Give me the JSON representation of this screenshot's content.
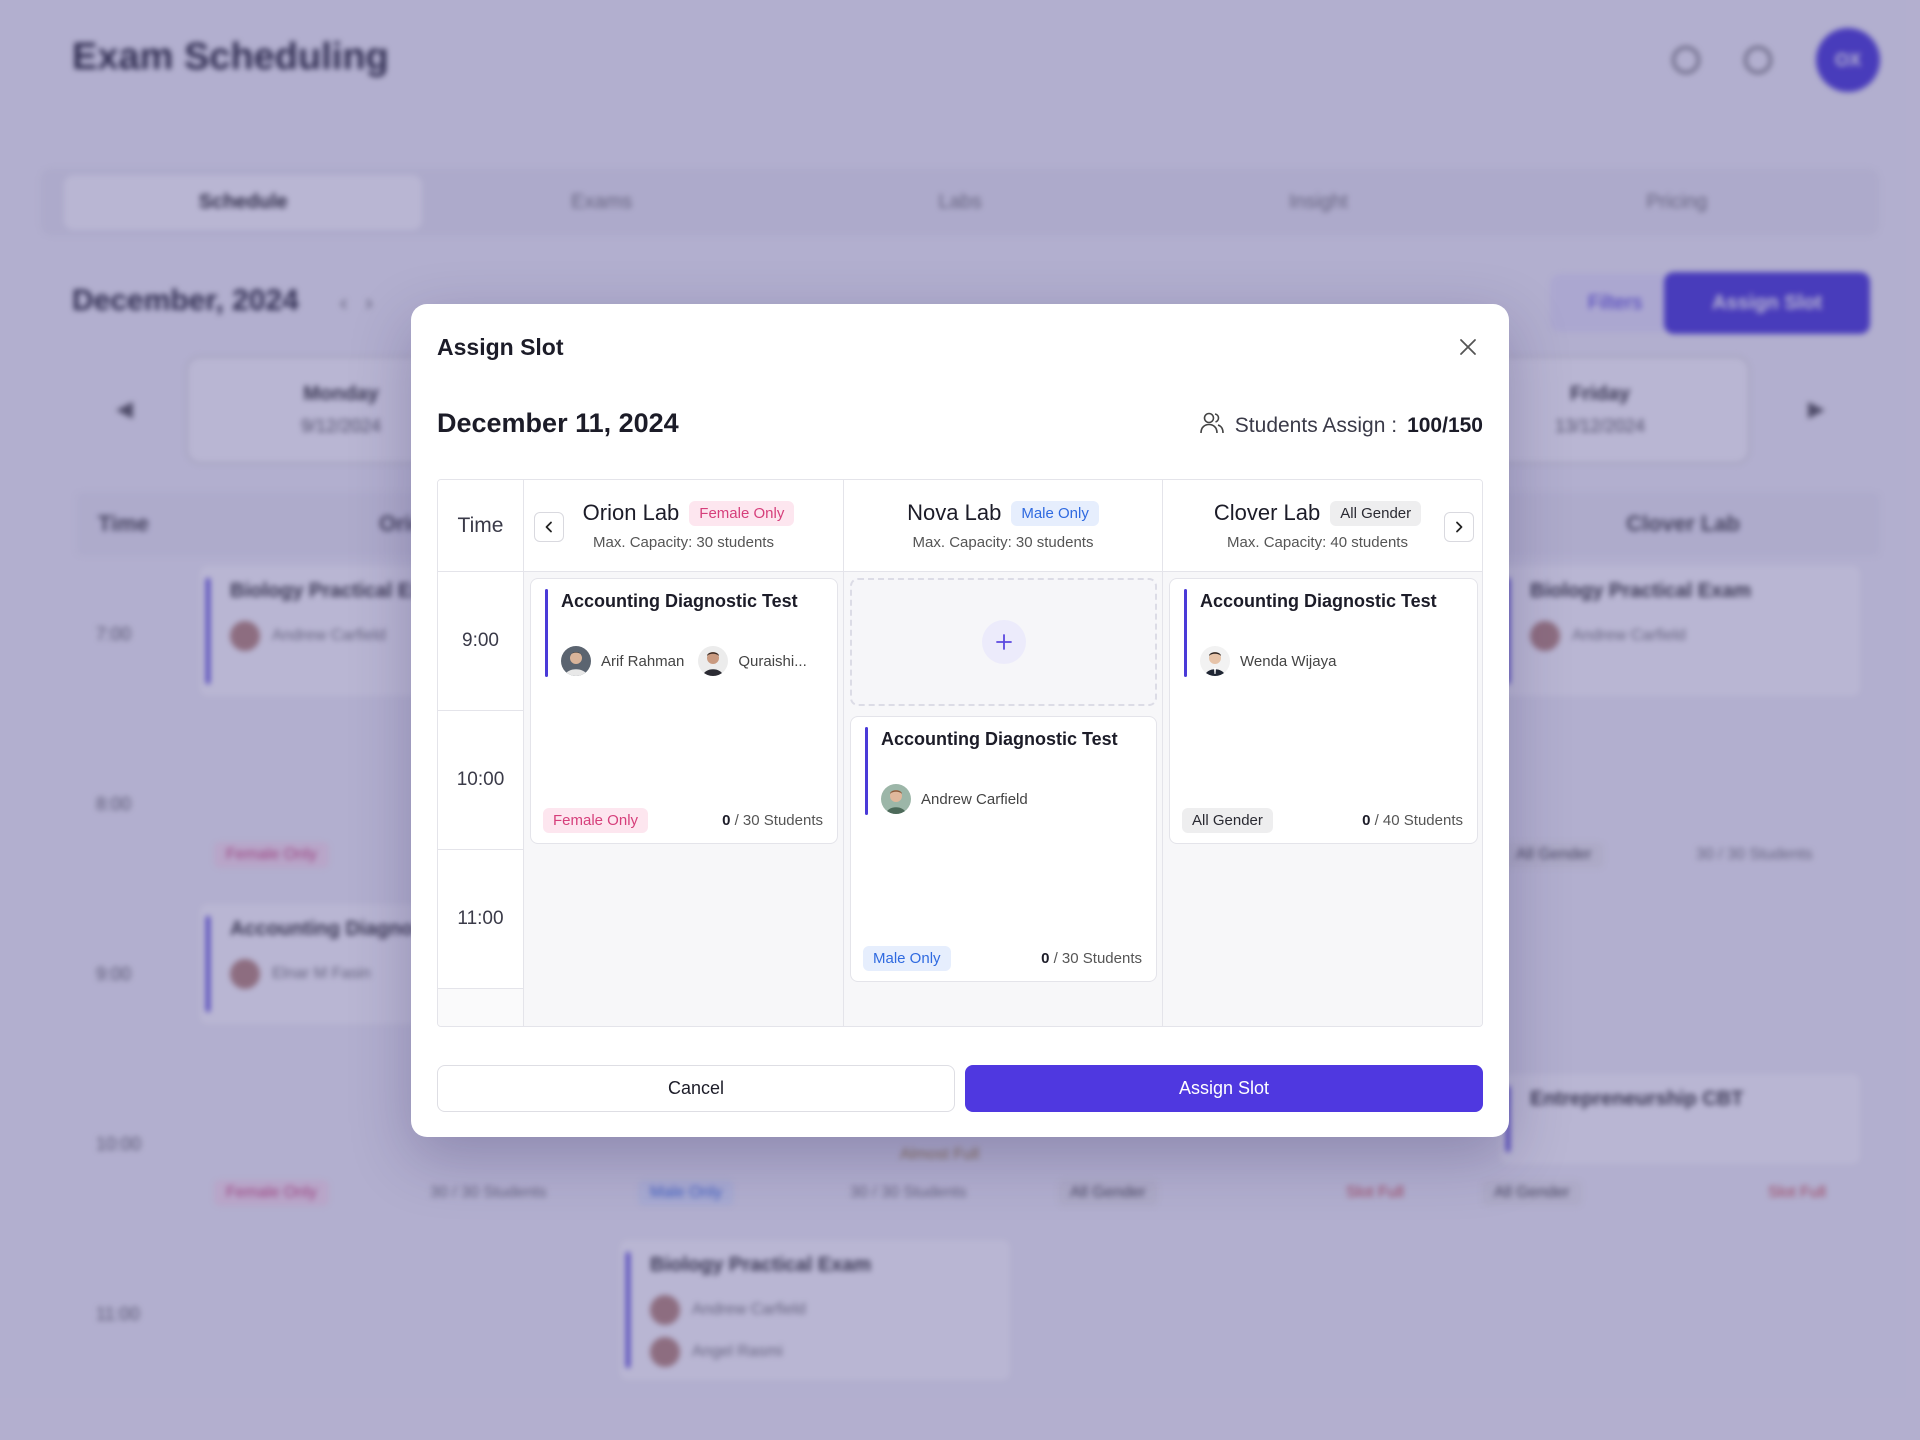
{
  "background": {
    "app_title": "Exam Scheduling",
    "avatar_initials": "OX",
    "tabs": [
      "Schedule",
      "Exams",
      "Labs",
      "Insight",
      "Pricing"
    ],
    "month": "December, 2024",
    "filters_label": "Filters",
    "assign_label": "Assign Slot",
    "monday": {
      "name": "Monday",
      "date": "9/12/2024"
    },
    "friday": {
      "name": "Friday",
      "date": "13/12/2024"
    },
    "grid_time": "Time",
    "grid_col1": "Orion Lab",
    "grid_col_last": "Clover Lab",
    "times": [
      "7:00",
      "8:00",
      "9:00",
      "10:00",
      "11:00"
    ],
    "card1_title": "Biology Practical Exam",
    "card2_title": "Accounting Diagnostic Test",
    "card3_title": "Entrepreneurship CBT",
    "bg_person1": "Andrew Carfield",
    "bg_person2": "Angel Rasmi",
    "bg_person3": "Elnar M Fasin",
    "bg_female": "Female Only",
    "bg_male": "Male Only",
    "bg_all": "All Gender",
    "bg_students": "30 / 30 Students",
    "bg_slotfull": "Slot Full",
    "bg_almost": "Almost Full"
  },
  "modal": {
    "title": "Assign Slot",
    "date": "December 11, 2024",
    "students_assign_label": "Students Assign :",
    "students_assign_value": "100/150",
    "time_header": "Time",
    "times": [
      "9:00",
      "10:00",
      "11:00"
    ],
    "labs": [
      {
        "name": "Orion Lab",
        "badge": "Female Only",
        "capacity": "Max. Capacity: 30 students"
      },
      {
        "name": "Nova Lab",
        "badge": "Male Only",
        "capacity": "Max. Capacity: 30 students"
      },
      {
        "name": "Clover Lab",
        "badge": "All Gender",
        "capacity": "Max. Capacity: 40 students"
      }
    ],
    "cards": {
      "orion": {
        "title": "Accounting Diagnostic Test",
        "people": [
          "Arif Rahman",
          "Quraishi..."
        ],
        "badge": "Female Only",
        "count_num": "0",
        "count_rest": " / 30 Students"
      },
      "nova": {
        "title": "Accounting Diagnostic Test",
        "people": [
          "Andrew Carfield"
        ],
        "badge": "Male Only",
        "count_num": "0",
        "count_rest": " / 30 Students"
      },
      "clover": {
        "title": "Accounting Diagnostic Test",
        "people": [
          "Wenda Wijaya"
        ],
        "badge": "All Gender",
        "count_num": "0",
        "count_rest": " / 40 Students"
      }
    },
    "cancel_label": "Cancel",
    "assign_label": "Assign Slot"
  },
  "colors": {
    "accent": "#4f38e0",
    "female": "#d63f7b",
    "male": "#2f6ae0",
    "overlay": "#483e8c"
  },
  "icons": [
    "close-icon",
    "users-icon",
    "chevron-left-icon",
    "chevron-right-icon",
    "plus-icon"
  ]
}
